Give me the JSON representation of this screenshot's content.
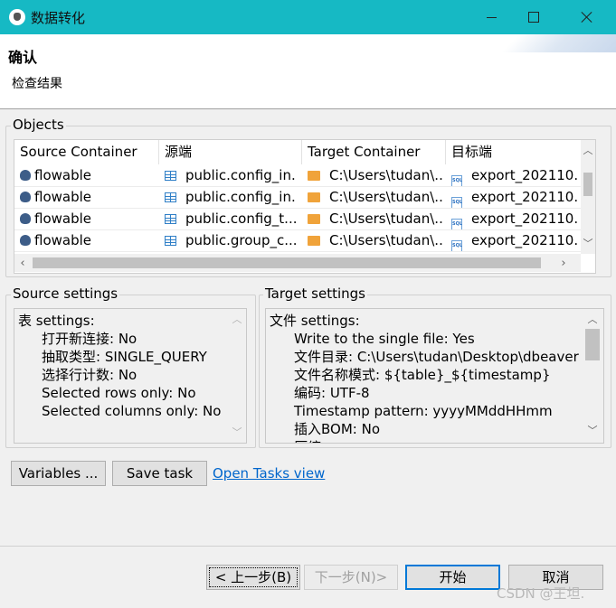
{
  "window": {
    "title": "数据转化"
  },
  "header": {
    "title": "确认",
    "description": "检查结果"
  },
  "objects": {
    "label": "Objects",
    "columns": [
      "Source Container",
      "源端",
      "Target Container",
      "目标端"
    ],
    "rows": [
      {
        "source_container": "flowable",
        "source": "public.config_in...",
        "target_container": "C:\\Users\\tudan\\...",
        "target": "export_202110..."
      },
      {
        "source_container": "flowable",
        "source": "public.config_in...",
        "target_container": "C:\\Users\\tudan\\...",
        "target": "export_202110..."
      },
      {
        "source_container": "flowable",
        "source": "public.config_t...",
        "target_container": "C:\\Users\\tudan\\...",
        "target": "export_202110..."
      },
      {
        "source_container": "flowable",
        "source": "public.group_c...",
        "target_container": "C:\\Users\\tudan\\...",
        "target": "export_202110..."
      }
    ]
  },
  "source_settings": {
    "label": "Source settings",
    "lines": [
      "表 settings:",
      "打开新连接: No",
      "抽取类型: SINGLE_QUERY",
      "选择行计数: No",
      "Selected rows only: No",
      "Selected columns only: No"
    ]
  },
  "target_settings": {
    "label": "Target settings",
    "lines": [
      "文件 settings:",
      "Write to the single file: Yes",
      "文件目录: C:\\Users\\tudan\\Desktop\\dbeaver",
      "文件名称模式: ${table}_${timestamp}",
      "编码: UTF-8",
      "Timestamp pattern: yyyyMMddHHmm",
      "插入BOM: No",
      "压缩"
    ]
  },
  "actions": {
    "variables_label": "Variables ...",
    "save_task_label": "Save task",
    "open_tasks_label": "Open Tasks view"
  },
  "footer": {
    "back_label": "< 上一步(B)",
    "next_label": "下一步(N)>",
    "start_label": "开始",
    "cancel_label": "取消"
  },
  "watermark": "CSDN @王坦."
}
